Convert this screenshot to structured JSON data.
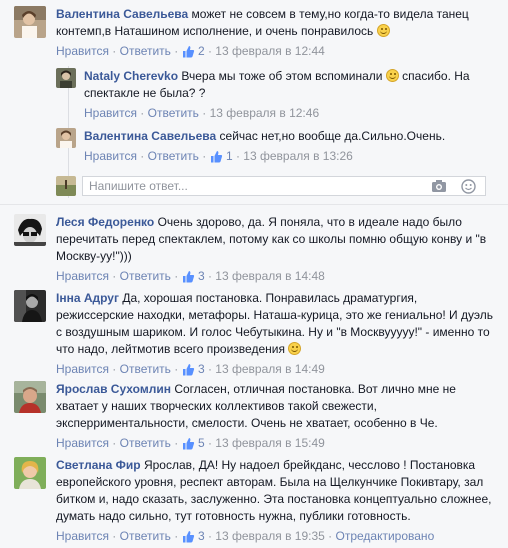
{
  "comments": [
    {
      "name": "Валентина Савельева",
      "text": "может не совсем в тему,но когда-то видела танец контемп,в Наташином исполнение, и очень понравилось",
      "like": "Нравится",
      "reply": "Ответить",
      "likes": "2",
      "time": "13 февраля в 12:44",
      "replies": [
        {
          "name": "Nataly Cherevko",
          "text": "Вчера мы тоже об этом вспоминали",
          "text2": "спасибо. На спектакле не была? ?",
          "like": "Нравится",
          "reply": "Ответить",
          "time": "13 февраля в 12:46"
        },
        {
          "name": "Валентина Савельева",
          "text": "сейчас нет,но вообще да.Сильно.Очень.",
          "like": "Нравится",
          "reply": "Ответить",
          "likes": "1",
          "time": "13 февраля в 13:26"
        }
      ],
      "reply_placeholder": "Напишите ответ..."
    },
    {
      "name": "Леся Федоренко",
      "text": "Очень здорово, да. Я поняла, что в идеале надо было перечитать перед спектаклем, потому как со школы помню общую конву и \"в Москву-уу!\")))",
      "like": "Нравится",
      "reply": "Ответить",
      "likes": "3",
      "time": "13 февраля в 14:48"
    },
    {
      "name": "Інна Адруг",
      "text": "Да, хорошая постановка. Понравилась драматургия, режиссерские находки, метафоры. Наташа-курица, это же гениально! И дуэль с воздушным шариком. И голос Чебутыкина. Ну и \"в Москвууууу!\" - именно то что надо, лейтмотив всего произведения",
      "like": "Нравится",
      "reply": "Ответить",
      "likes": "3",
      "time": "13 февраля в 14:49"
    },
    {
      "name": "Ярослав Сухомлин",
      "text": "Согласен, отличная постановка. Вот лично мне не хватает у наших творческих коллективов такой свежести, эксперриментальности, смелости. Очень не хватает, особенно в Че.",
      "like": "Нравится",
      "reply": "Ответить",
      "likes": "5",
      "time": "13 февраля в 15:49"
    },
    {
      "name": "Светлана Фир",
      "text": "Ярослав, ДА! Ну надоел брейкданс, чесслово ! Постановка европейского уровня, респект авторам. Была на Щелкунчике Покивтару, зал битком и, надо сказать, заслуженно. Эта постановка концептуально сложнее, думать надо сильно, тут готовность нужна, публики готовность.",
      "like": "Нравится",
      "reply": "Ответить",
      "likes": "3",
      "time": "13 февраля в 19:35",
      "edited": "Отредактировано"
    }
  ],
  "colors": {
    "name": "#3b5998",
    "link": "#6d84b4",
    "meta": "#90949c"
  },
  "icons": [
    "smile-emoji-icon",
    "thumbs-up-icon",
    "camera-icon",
    "sticker-icon"
  ]
}
